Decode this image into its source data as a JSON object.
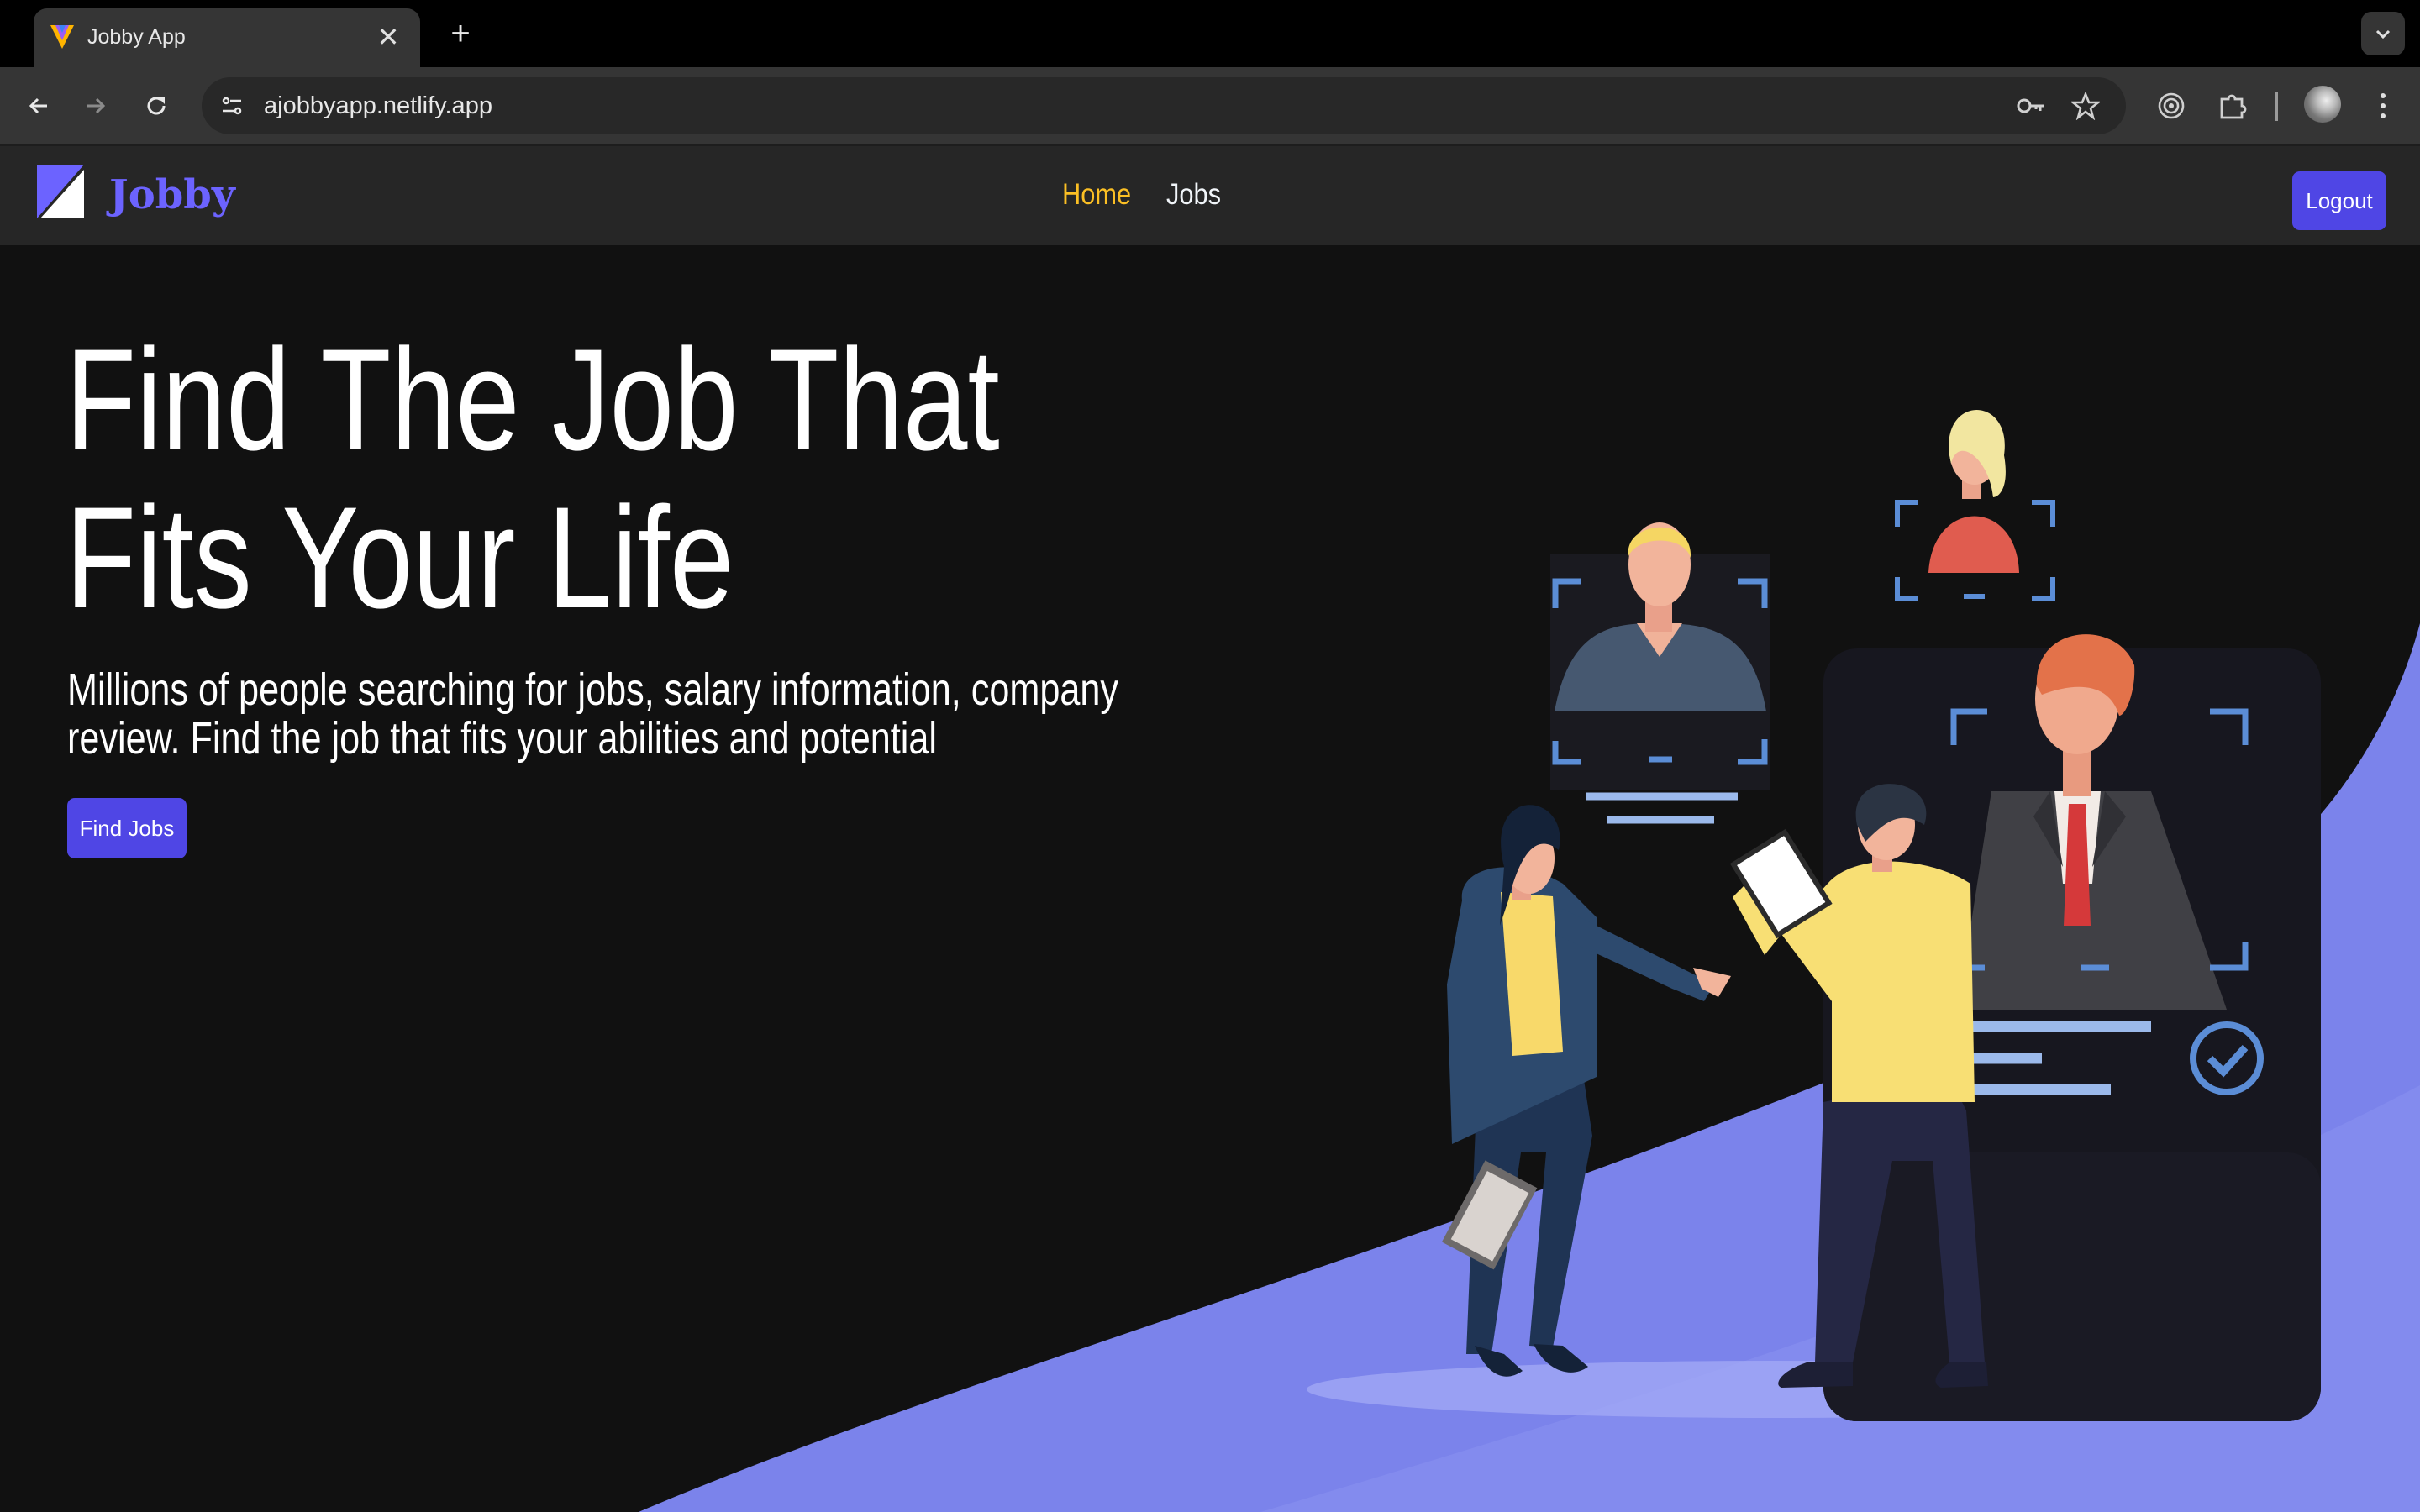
{
  "browser": {
    "tab_title": "Jobby App",
    "url": "ajobbyapp.netlify.app"
  },
  "navbar": {
    "logo_text": "Jobby",
    "links": [
      {
        "label": "Home",
        "active": true
      },
      {
        "label": "Jobs",
        "active": false
      }
    ],
    "logout_label": "Logout"
  },
  "hero": {
    "heading_line1": "Find The Job That",
    "heading_line2": "Fits Your Life",
    "description_line1": "Millions of people searching for jobs, salary information, company",
    "description_line2": "review. Find the job that fits your abilities and potential",
    "cta_label": "Find Jobs"
  },
  "colors": {
    "brand": "#6c63ff",
    "button": "#4f46e5",
    "active_link": "#fbbf24",
    "background": "#111111",
    "navbar": "#262626",
    "wave": "#7b83eb"
  },
  "icons": [
    "jobby-favicon-icon",
    "close-icon",
    "plus-icon",
    "chevron-down-icon",
    "back-arrow-icon",
    "forward-arrow-icon",
    "reload-icon",
    "site-info-icon",
    "key-icon",
    "star-icon",
    "target-icon",
    "extensions-icon",
    "kebab-menu-icon",
    "jobby-logo-icon",
    "checkmark-circle-icon"
  ]
}
